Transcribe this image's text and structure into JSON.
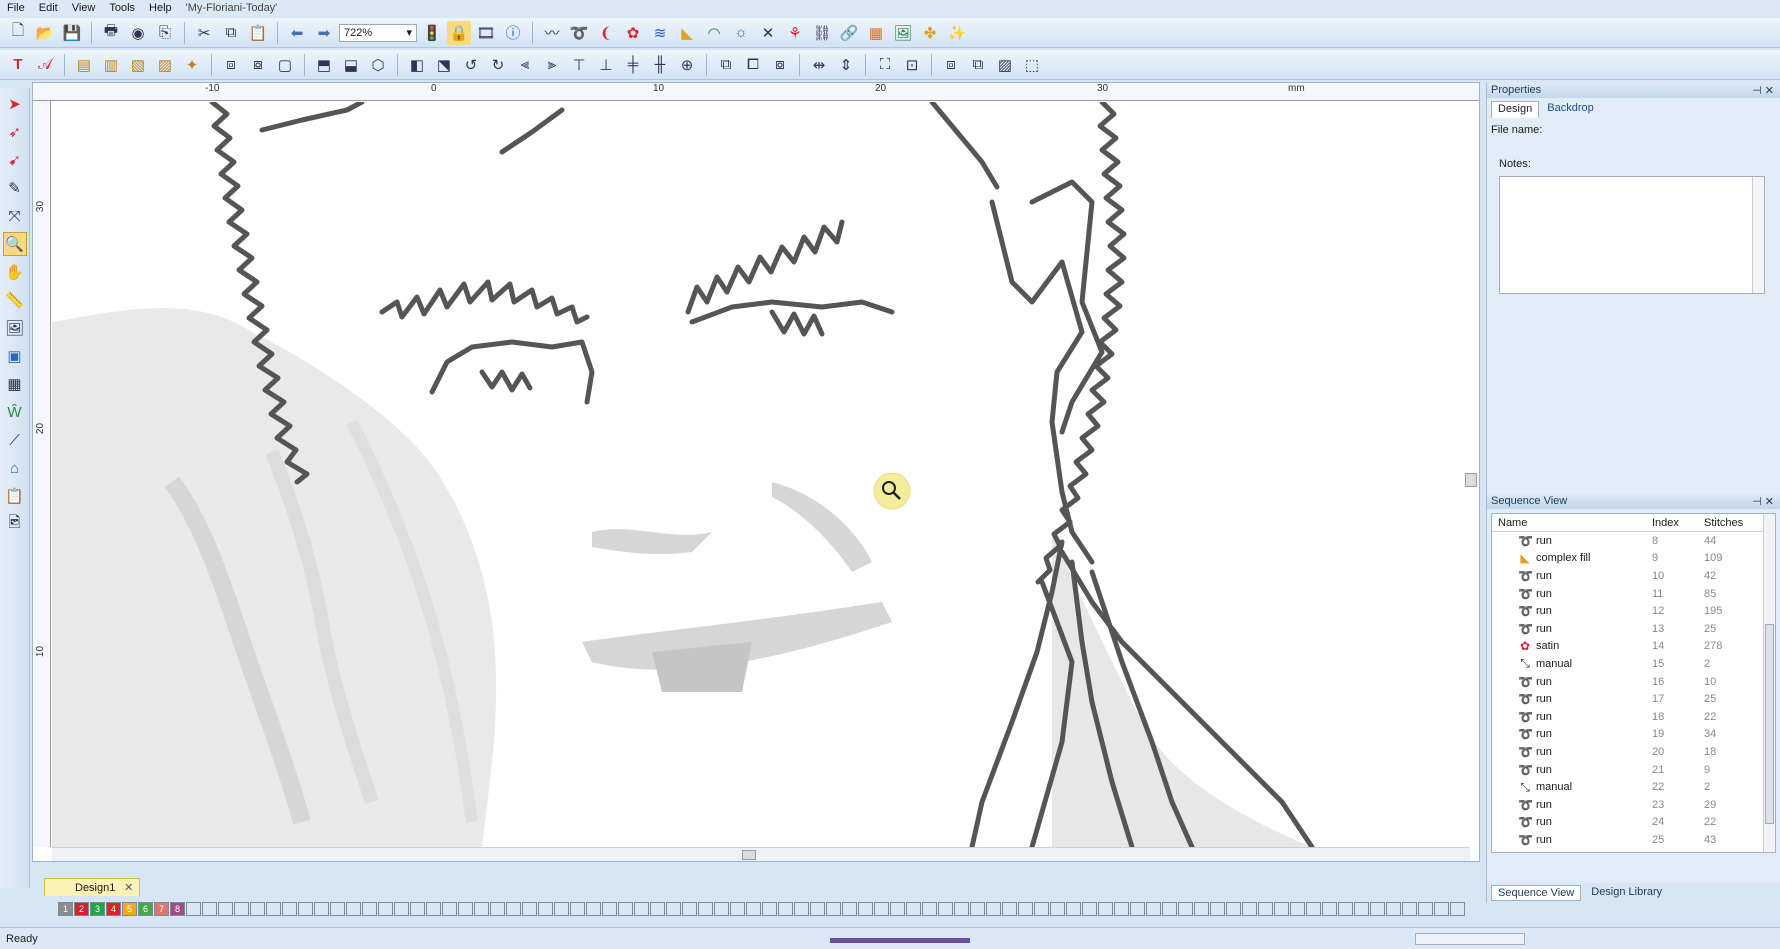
{
  "menu": [
    "File",
    "Edit",
    "View",
    "Tools",
    "Help"
  ],
  "document_title": "'My-Floriani-Today'",
  "zoom": "722%",
  "ruler": {
    "unit": "mm",
    "h_ticks": [
      "-10",
      "0",
      "10",
      "20",
      "30"
    ],
    "v_ticks": [
      "30",
      "20",
      "10"
    ]
  },
  "doc_tab": "Design1",
  "properties": {
    "title": "Properties",
    "tabs": [
      "Design",
      "Backdrop"
    ],
    "file_name_label": "File name:",
    "notes_label": "Notes:"
  },
  "sequence": {
    "title": "Sequence View",
    "headers": {
      "name": "Name",
      "index": "Index",
      "stitches": "Stitches"
    },
    "rows": [
      {
        "name": "run",
        "icon": "run-icon",
        "index": "8",
        "stitches": "44"
      },
      {
        "name": "complex fill",
        "icon": "complex-fill-icon",
        "index": "9",
        "stitches": "109"
      },
      {
        "name": "run",
        "icon": "run-icon",
        "index": "10",
        "stitches": "42"
      },
      {
        "name": "run",
        "icon": "run-icon",
        "index": "11",
        "stitches": "85"
      },
      {
        "name": "run",
        "icon": "run-icon",
        "index": "12",
        "stitches": "195"
      },
      {
        "name": "run",
        "icon": "run-icon",
        "index": "13",
        "stitches": "25"
      },
      {
        "name": "satin",
        "icon": "satin-icon",
        "index": "14",
        "stitches": "278"
      },
      {
        "name": "manual",
        "icon": "manual-icon",
        "index": "15",
        "stitches": "2"
      },
      {
        "name": "run",
        "icon": "run-icon",
        "index": "16",
        "stitches": "10"
      },
      {
        "name": "run",
        "icon": "run-icon",
        "index": "17",
        "stitches": "25"
      },
      {
        "name": "run",
        "icon": "run-icon",
        "index": "18",
        "stitches": "22"
      },
      {
        "name": "run",
        "icon": "run-icon",
        "index": "19",
        "stitches": "34"
      },
      {
        "name": "run",
        "icon": "run-icon",
        "index": "20",
        "stitches": "18"
      },
      {
        "name": "run",
        "icon": "run-icon",
        "index": "21",
        "stitches": "9"
      },
      {
        "name": "manual",
        "icon": "manual-icon",
        "index": "22",
        "stitches": "2"
      },
      {
        "name": "run",
        "icon": "run-icon",
        "index": "23",
        "stitches": "29"
      },
      {
        "name": "run",
        "icon": "run-icon",
        "index": "24",
        "stitches": "22"
      },
      {
        "name": "run",
        "icon": "run-icon",
        "index": "25",
        "stitches": "43"
      }
    ],
    "bottom_tabs": [
      "Sequence View",
      "Design Library"
    ]
  },
  "colors": [
    {
      "label": "1",
      "hex": "#8c8c8c"
    },
    {
      "label": "2",
      "hex": "#d81e2a"
    },
    {
      "label": "3",
      "hex": "#1fa64b"
    },
    {
      "label": "4",
      "hex": "#d9262b"
    },
    {
      "label": "5",
      "hex": "#f2a81d"
    },
    {
      "label": "6",
      "hex": "#46a84a"
    },
    {
      "label": "7",
      "hex": "#e0736f"
    },
    {
      "label": "8",
      "hex": "#a64a86"
    }
  ],
  "status": "Ready"
}
